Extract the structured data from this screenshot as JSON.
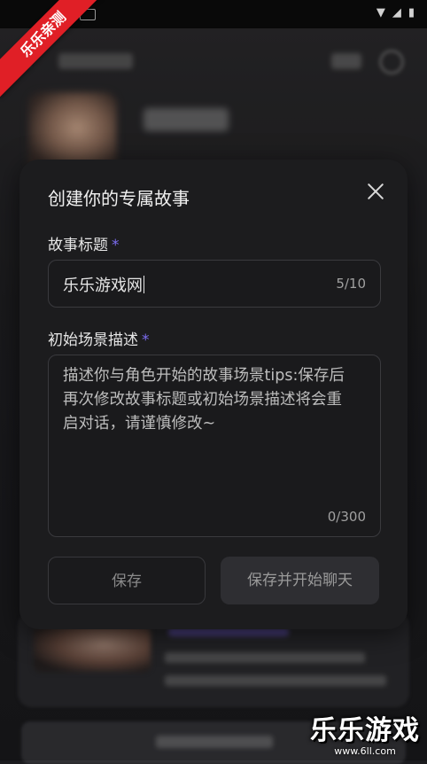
{
  "watermark": {
    "corner_label": "乐乐亲测",
    "logo_main": "乐乐游戏",
    "logo_sub": "www.6ll.com"
  },
  "modal": {
    "title": "创建你的专属故事",
    "story_title": {
      "label": "故事标题",
      "required_mark": "*",
      "value": "乐乐游戏网",
      "counter": "5/10"
    },
    "scene_description": {
      "label": "初始场景描述",
      "required_mark": "*",
      "placeholder": "描述你与角色开始的故事场景tips:保存后再次修改故事标题或初始场景描述将会重启对话，请谨慎修改~",
      "counter": "0/300"
    },
    "buttons": {
      "save": "保存",
      "save_and_chat": "保存并开始聊天"
    }
  },
  "colors": {
    "modal_bg": "#1c1c1e",
    "accent": "#7b6cf0",
    "watermark_red": "#e01f26"
  }
}
